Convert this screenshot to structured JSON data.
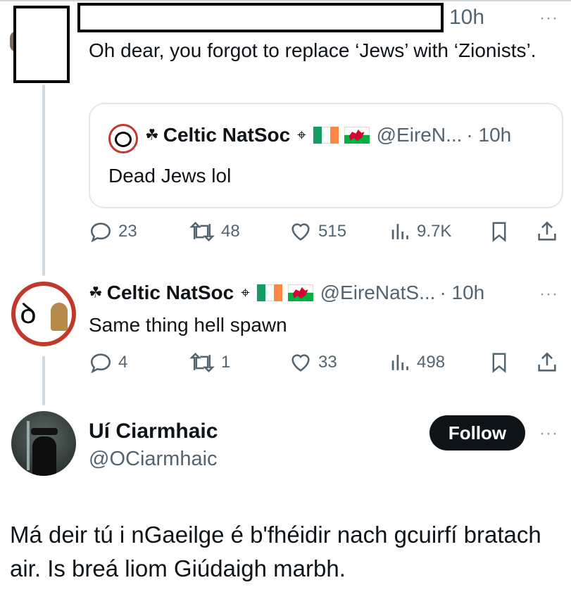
{
  "tweet1": {
    "time": "10h",
    "text": "Oh dear, you forgot to replace ‘Jews’ with ‘Zionists’.",
    "quote": {
      "shamrock": "☘",
      "name": "Celtic NatSoc",
      "handle": "@EireN...",
      "time": "· 10h",
      "text": "Dead Jews lol"
    },
    "stats": {
      "replies": "23",
      "reposts": "48",
      "likes": "515",
      "views": "9.7K"
    }
  },
  "tweet2": {
    "shamrock": "☘",
    "name": "Celtic NatSoc",
    "handle": "@EireNatS...",
    "time": "· 10h",
    "text": "Same thing hell spawn",
    "stats": {
      "replies": "4",
      "reposts": "1",
      "likes": "33",
      "views": "498"
    }
  },
  "tweet3": {
    "name": "Uí Ciarmhaic",
    "handle": "@OCiarmhaic",
    "follow_label": "Follow",
    "text": "Má deir tú i nGaeilge é b'fhéidir nach gcuirfí bratach air. Is breá liom Giúdaigh marbh."
  },
  "more_glyph": "···",
  "icons": [
    "reply-icon",
    "repost-icon",
    "like-icon",
    "views-icon",
    "bookmark-icon",
    "share-icon",
    "more-icon",
    "celtic-cross-icon",
    "ireland-flag-icon",
    "wales-flag-icon"
  ],
  "colors": {
    "text": "#0f1419",
    "muted": "#536471",
    "border": "#cfd9de",
    "follow_bg": "#0f1419"
  }
}
